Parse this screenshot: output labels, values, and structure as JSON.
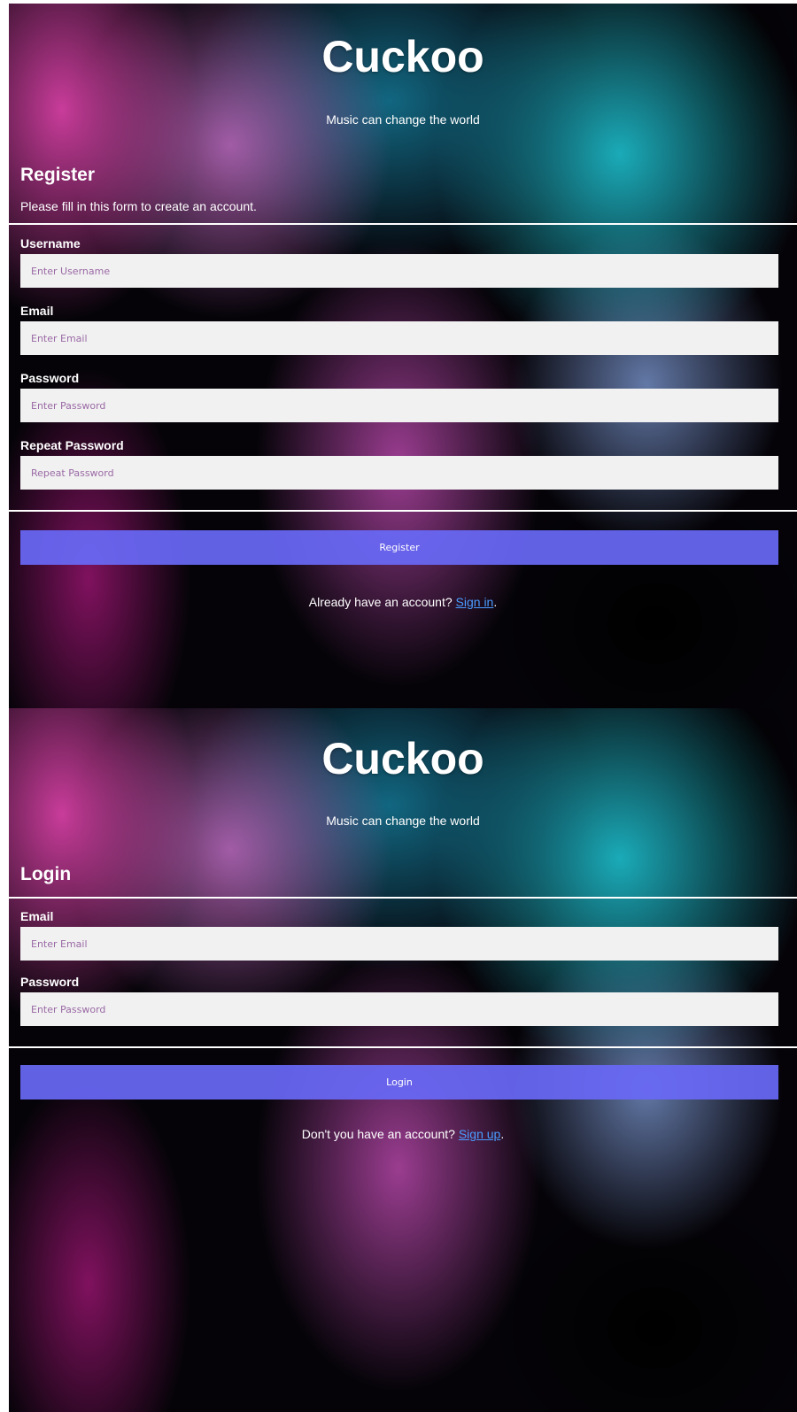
{
  "colors": {
    "text": "#ffffff",
    "input_background": "#f1f1f1",
    "placeholder": "#9a69a5",
    "button_background": "#6868f5",
    "link": "#4a9cff"
  },
  "register": {
    "brand": "Cuckoo",
    "tagline": "Music can change the world",
    "title": "Register",
    "subtitle": "Please fill in this form to create an account.",
    "fields": [
      {
        "label": "Username",
        "placeholder": "Enter Username"
      },
      {
        "label": "Email",
        "placeholder": "Enter Email"
      },
      {
        "label": "Password",
        "placeholder": "Enter Password"
      },
      {
        "label": "Repeat Password",
        "placeholder": "Repeat Password"
      }
    ],
    "submit_label": "Register",
    "switch_text": "Already have an account? ",
    "switch_link": "Sign in",
    "switch_end": "."
  },
  "login": {
    "brand": "Cuckoo",
    "tagline": "Music can change the world",
    "title": "Login",
    "fields": [
      {
        "label": "Email",
        "placeholder": "Enter Email"
      },
      {
        "label": "Password",
        "placeholder": "Enter Password"
      }
    ],
    "submit_label": "Login",
    "switch_text": "Don't you have an account? ",
    "switch_link": "Sign up",
    "switch_end": "."
  }
}
